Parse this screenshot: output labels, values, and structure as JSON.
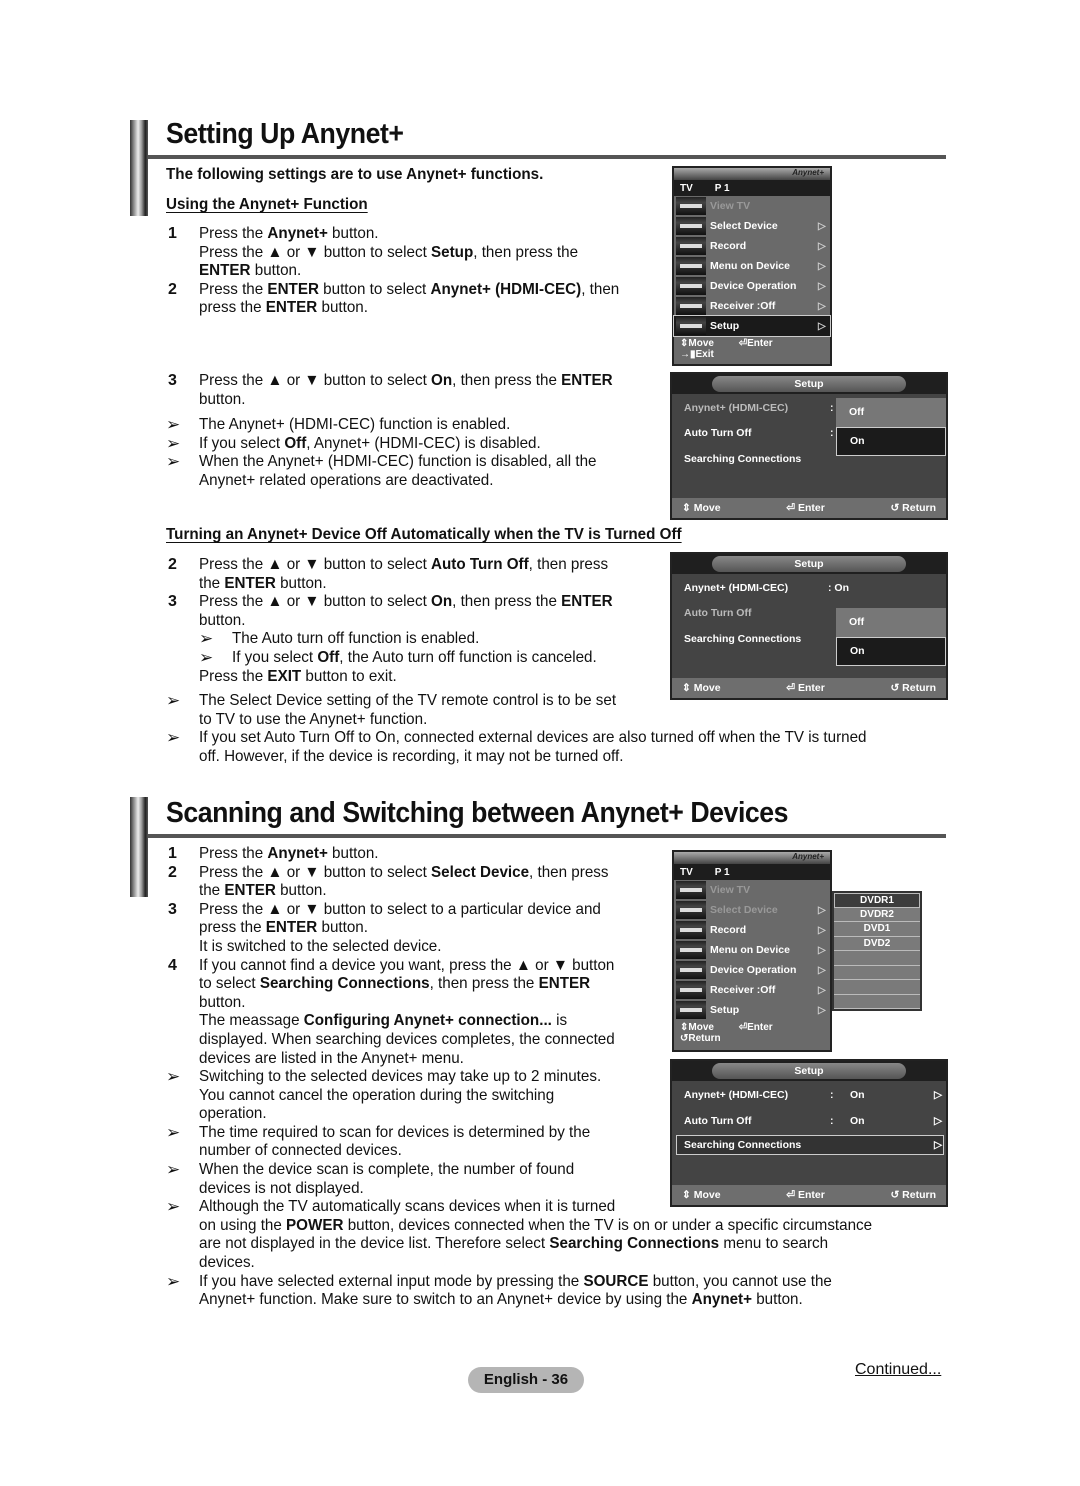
{
  "section1": {
    "title": "Setting Up Anynet+",
    "intro": "The following settings are to use Anynet+ functions.",
    "subhead": "Using the Anynet+ Function",
    "steps": [
      {
        "num": "1",
        "lines": [
          "Press the <b>Anynet+</b> button.",
          "Press the ▲ or ▼ button to select <b>Setup</b>, then press the",
          "<b>ENTER</b> button."
        ]
      },
      {
        "num": "2",
        "lines": [
          "Press the <b>ENTER</b> button to select <b>Anynet+ (HDMI-CEC)</b>, then",
          "press the <b>ENTER</b> button."
        ]
      },
      {
        "num": "3",
        "lines": [
          "Press the ▲ or ▼ button to select <b>On</b>, then press the <b>ENTER</b>",
          "button."
        ]
      }
    ],
    "notes": [
      [
        "The Anynet+ (HDMI-CEC) function is enabled."
      ],
      [
        "If you select <b>Off</b>, Anynet+ (HDMI-CEC) is disabled."
      ],
      [
        "When the Anynet+ (HDMI-CEC) function is disabled, all the",
        "Anynet+ related operations are deactivated."
      ]
    ]
  },
  "section1b": {
    "subhead": "Turning an Anynet+ Device Off Automatically when the TV is Turned Off",
    "steps": [
      {
        "num": "2",
        "lines": [
          "Press the ▲ or ▼ button to select <b>Auto Turn Off</b>, then press",
          "the <b>ENTER</b> button."
        ]
      },
      {
        "num": "3",
        "lines": [
          "Press the ▲ or ▼ button to select <b>On</b>, then press the <b>ENTER</b>",
          "button."
        ]
      }
    ],
    "subnotes": [
      "The Auto turn off function is enabled.",
      "If you select <b>Off</b>, the Auto turn off function is canceled."
    ],
    "exit_line": "Press the <b>EXIT</b> button to exit.",
    "notes": [
      [
        "The Select Device setting of the TV remote control is to be set",
        "to TV to use the Anynet+ function."
      ],
      [
        "If you set Auto Turn Off to On, connected external devices are also turned off when the TV is turned",
        "off. However, if the device is recording, it may not be turned off."
      ]
    ]
  },
  "section2": {
    "title": "Scanning and Switching between Anynet+ Devices",
    "steps": [
      {
        "num": "1",
        "lines": [
          "Press the <b>Anynet+</b> button."
        ]
      },
      {
        "num": "2",
        "lines": [
          "Press the ▲ or ▼ button to select <b>Select Device</b>, then press",
          "the <b>ENTER</b> button."
        ]
      },
      {
        "num": "3",
        "lines": [
          "Press the ▲ or ▼ button to select to a particular device and",
          "press the <b>ENTER</b> button.",
          "It is switched to the selected device."
        ]
      },
      {
        "num": "4",
        "lines": [
          "If you cannot find a device you want, press the ▲ or ▼ button",
          "to select <b>Searching Connections</b>, then press the <b>ENTER</b>",
          "button.",
          "The meassage <b>Configuring Anynet+ connection...</b> is",
          "displayed. When searching devices completes, the connected",
          "devices are listed in the Anynet+ menu."
        ]
      }
    ],
    "notes": [
      [
        "Switching to the selected devices may take up to 2 minutes.",
        "You cannot cancel the operation during the switching",
        "operation."
      ],
      [
        "The time required to scan for devices is determined by the",
        "number of connected devices."
      ],
      [
        "When the device scan is complete, the number of found",
        "devices is not displayed."
      ],
      [
        "Although the TV automatically scans devices when it is turned",
        "on using the <b>POWER</b> button, devices connected when the TV is on or under a specific circumstance",
        "are not displayed in the device list. Therefore select <b>Searching Connections</b> menu to search",
        "devices."
      ],
      [
        "If you have selected external input mode by pressing the <b>SOURCE</b> button, you cannot use the",
        "Anynet+ function. Make sure to switch to an Anynet+ device by using the <b>Anynet+</b> button."
      ]
    ]
  },
  "anynet_menu": {
    "logo": "Anynet+",
    "tv_label": "TV",
    "channel": "P 1",
    "items": [
      {
        "label": "View TV",
        "icon": "tv-icon"
      },
      {
        "label": "Select Device",
        "icon": "cable-icon"
      },
      {
        "label": "Record",
        "icon": "recorder-icon"
      },
      {
        "label": "Menu on Device",
        "icon": "device-menu-icon"
      },
      {
        "label": "Device Operation",
        "icon": "device-operation-icon"
      },
      {
        "label": "Receiver    :Off",
        "icon": "speaker-icon"
      },
      {
        "label": "Setup",
        "icon": "gear-icon"
      }
    ],
    "move": "Move",
    "enter": "Enter",
    "exit": "Exit",
    "return": "Return"
  },
  "setup_menu": {
    "title": "Setup",
    "anynet": "Anynet+ (HDMI-CEC)",
    "auto_off": "Auto Turn Off",
    "searching": "Searching Connections",
    "opt_off": "Off",
    "opt_on": "On",
    "anynet_value": ": On",
    "colon": ":",
    "on": "On",
    "move": "Move",
    "enter": "Enter",
    "return": "Return"
  },
  "device_list": [
    "DVDR1",
    "DVDR2",
    "DVD1",
    "DVD2",
    "",
    "",
    "",
    ""
  ],
  "footer": {
    "page": "English - 36",
    "continued": "Continued..."
  }
}
